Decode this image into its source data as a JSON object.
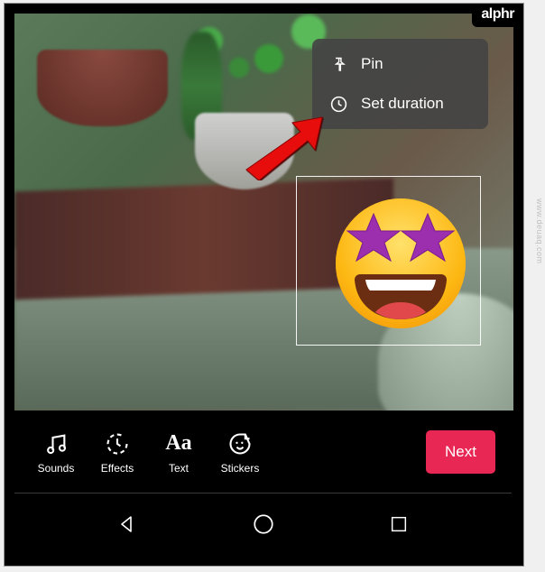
{
  "brand": "alphr",
  "watermark": "www.deuaq.com",
  "context_menu": {
    "pin": "Pin",
    "set_duration": "Set duration"
  },
  "sticker": {
    "emoji_name": "star-struck-emoji",
    "selected": true
  },
  "toolbar": {
    "sounds": "Sounds",
    "effects": "Effects",
    "text": "Text",
    "stickers": "Stickers",
    "next": "Next"
  },
  "colors": {
    "accent": "#e92754"
  }
}
